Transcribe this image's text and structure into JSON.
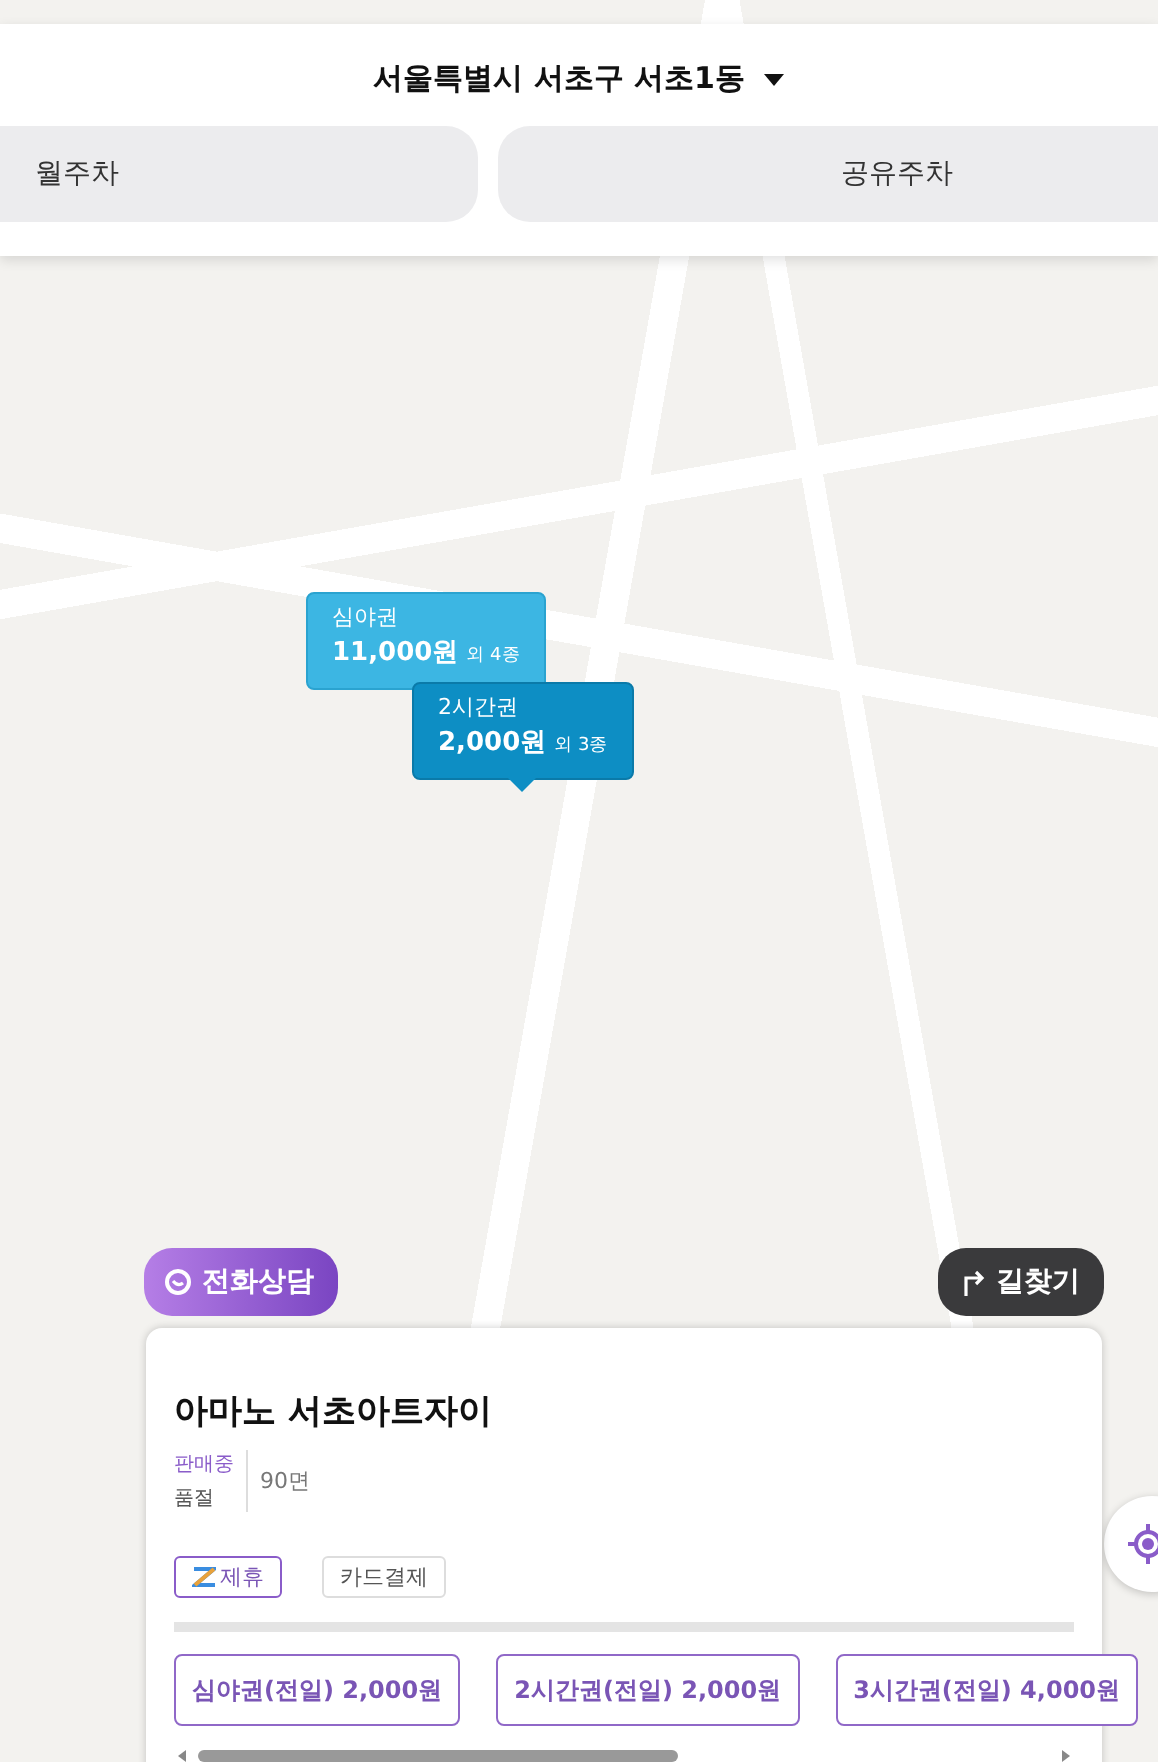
{
  "location": {
    "title": "서울특별시 서초구 서초1동"
  },
  "tabs": [
    {
      "label": "월주차"
    },
    {
      "label": "공유주차"
    }
  ],
  "price_markers": [
    {
      "name": "심야권",
      "price": "11,000원",
      "extra": "외 4종",
      "selected": false
    },
    {
      "name": "2시간권",
      "price": "2,000원",
      "extra": "외 3종",
      "selected": true
    }
  ],
  "actions": {
    "call": "전화상담",
    "directions": "길찾기"
  },
  "parking_lot": {
    "name": "아마노 서초아트자이",
    "status": [
      {
        "label": "판매중",
        "active": true
      },
      {
        "label": "품절",
        "active": false
      }
    ],
    "spaces": "90면",
    "tags": [
      {
        "label": "제휴",
        "kind": "partner"
      },
      {
        "label": "카드결제",
        "kind": "plain"
      }
    ],
    "tickets": [
      "심야권(전일) 2,000원",
      "2시간권(전일) 2,000원",
      "3시간권(전일) 4,000원"
    ]
  }
}
